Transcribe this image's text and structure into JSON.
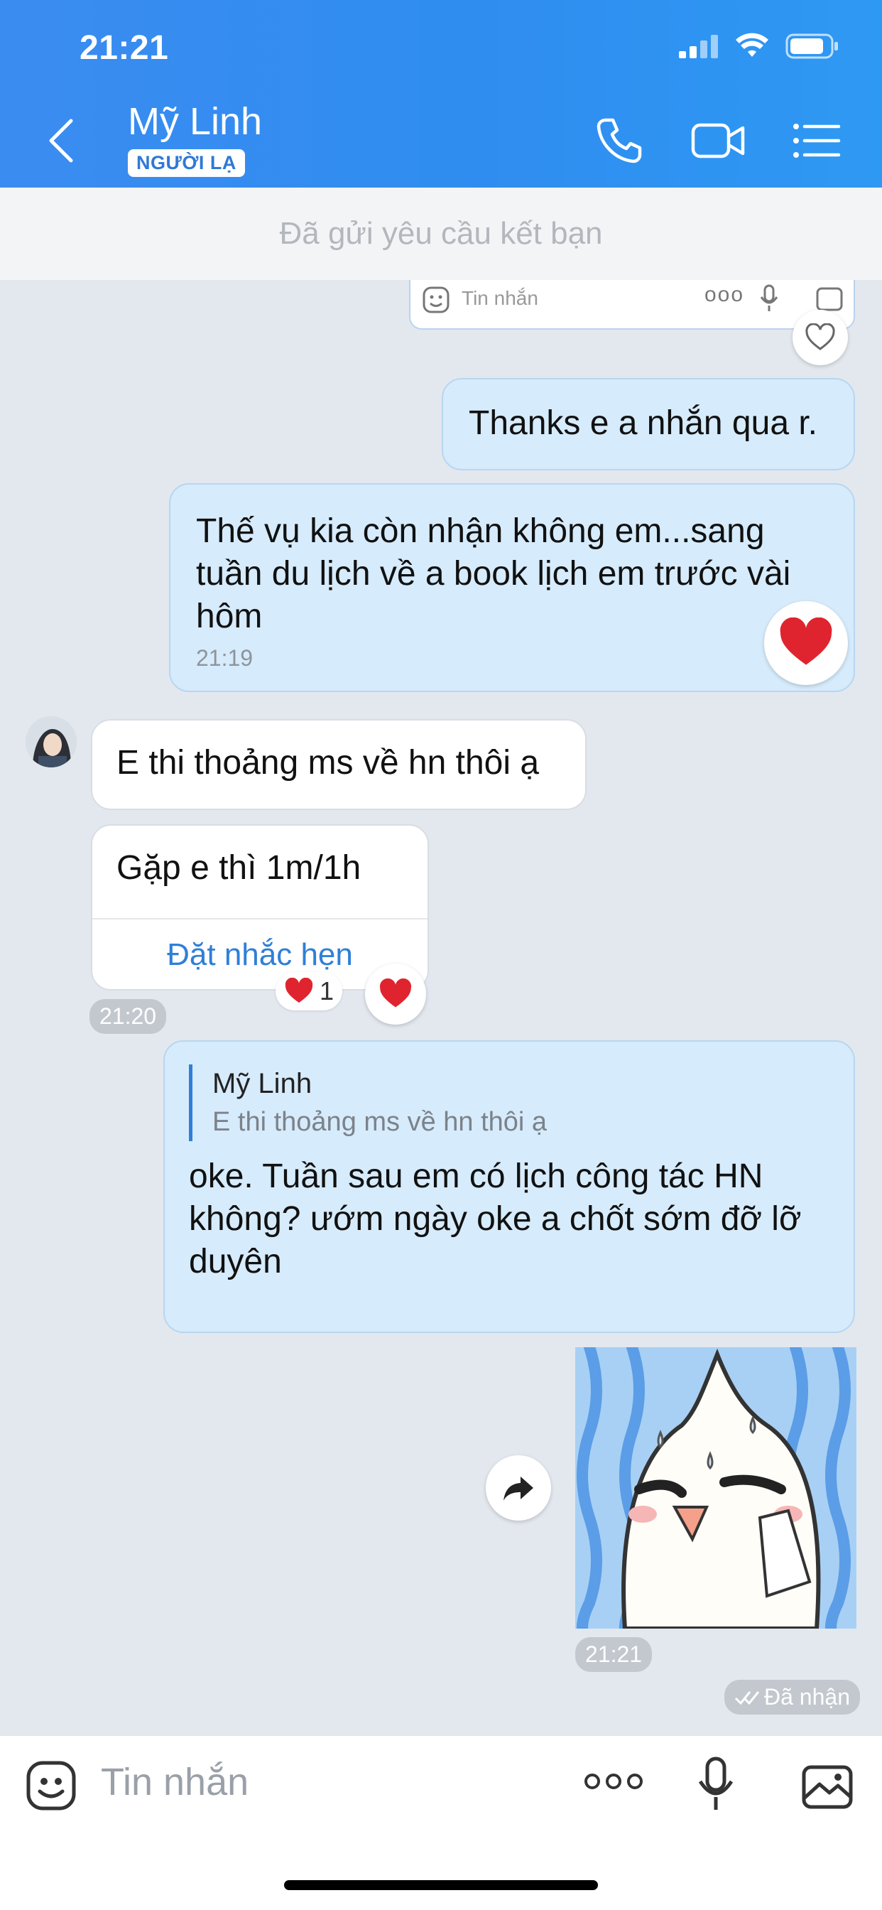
{
  "status_bar": {
    "time": "21:21"
  },
  "header": {
    "contact_name": "Mỹ Linh",
    "badge": "NGƯỜI LẠ",
    "icons": [
      "back-arrow-icon",
      "phone-icon",
      "video-icon",
      "menu-list-icon"
    ]
  },
  "banner": {
    "text": "Đã gửi yêu cầu kết bạn"
  },
  "partial_input_preview": {
    "placeholder": "Tin nhắn"
  },
  "messages": [
    {
      "sender": "me",
      "text": "Thanks e a nhắn qua r."
    },
    {
      "sender": "me",
      "text": "Thế vụ kia còn nhận không em...sang tuần du lịch về a book lịch em trước vài hôm",
      "time": "21:19",
      "reaction": "❤️"
    },
    {
      "sender": "Mỹ Linh",
      "text": "E thi thoảng ms về hn thôi ạ"
    },
    {
      "sender": "Mỹ Linh",
      "text": "Gặp e thì 1m/1h",
      "action": "Đặt nhắc hẹn",
      "reaction_count": "1",
      "time": "21:20"
    },
    {
      "sender": "me",
      "quote_name": "Mỹ Linh",
      "quote_text": "E thi thoảng ms về hn thôi ạ",
      "text": "oke. Tuần sau em có lịch công tác HN không? ướm ngày oke a chốt sớm đỡ lỡ duyên"
    },
    {
      "sender": "me",
      "type": "sticker",
      "time": "21:21",
      "status": "Đã nhận"
    }
  ],
  "input_bar": {
    "placeholder": "Tin nhắn"
  },
  "colors": {
    "header_blue": "#2f8df0",
    "my_bubble": "#d6ebfb",
    "link_blue": "#2f7fd8",
    "heart_red": "#e0242f"
  }
}
